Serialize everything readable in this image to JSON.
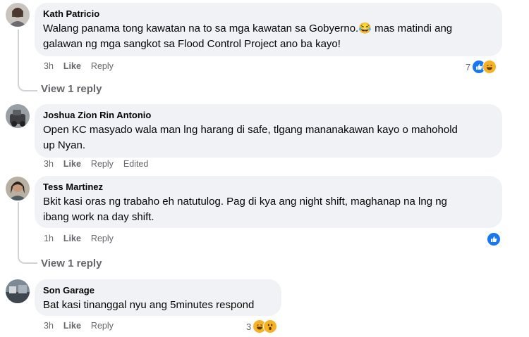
{
  "comments": [
    {
      "author": "Kath Patricio",
      "line1": "Walang panama tong kawatan na to sa mga kawatan sa Gobyerno.",
      "emoji1": "😂",
      "line1b": " mas matindi ang",
      "line2": "galawan ng mga sangkot sa Flood Control Project ano ba kayo!",
      "time": "3h",
      "like": "Like",
      "reply": "Reply",
      "reaction_count": "7",
      "reactions": [
        "like-icon",
        "haha-icon"
      ],
      "view_replies": "View 1 reply"
    },
    {
      "author": "Joshua Zion Rin Antonio",
      "line1": "Open KC masyado wala man lng harang di safe, tlgang mananakawan kayo o mahohold",
      "line2": "up Nyan.",
      "time": "3h",
      "like": "Like",
      "reply": "Reply",
      "edited": "Edited"
    },
    {
      "author": "Tess Martinez",
      "line1": "Bkit kasi oras ng trabaho eh natutulog. Pag di kya ang night shift, maghanap na lng ng",
      "line2": "ibang work na day shift.",
      "time": "1h",
      "like": "Like",
      "reply": "Reply",
      "reactions": [
        "like-icon"
      ],
      "view_replies": "View 1 reply"
    },
    {
      "author": "Son Garage",
      "line1": "Bat kasi tinanggal nyu ang 5minutes respond",
      "time": "3h",
      "like": "Like",
      "reply": "Reply",
      "reaction_count": "3",
      "reactions": [
        "haha-icon",
        "wow-icon"
      ]
    }
  ],
  "colors": {
    "bubble": "#f0f2f5",
    "meta": "#65676b",
    "like_blue": "#1877f2",
    "emoji_yellow": "#f7b125"
  }
}
